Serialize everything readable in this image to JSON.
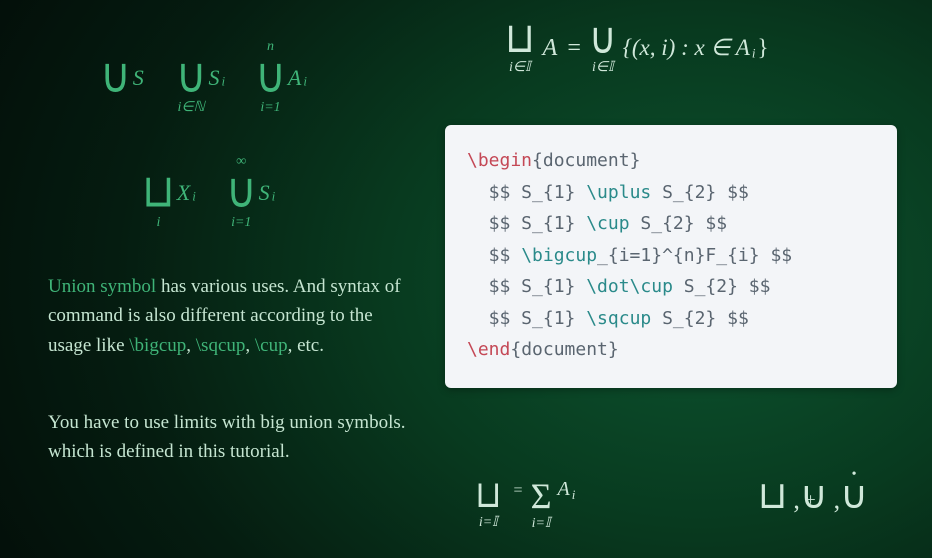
{
  "formulas": {
    "row1": {
      "t1": {
        "glyph": "∪",
        "body": "S"
      },
      "t2": {
        "glyph": "∪",
        "sub": "i∈ℕ",
        "body": "S",
        "bodysub": "i"
      },
      "t3": {
        "glyph": "∪",
        "sup": "n",
        "sub": "i=1",
        "body": "A",
        "bodysub": "i"
      }
    },
    "row2": {
      "t1": {
        "glyph": "⊔",
        "sub": "i",
        "body": "X",
        "bodysub": "i"
      },
      "t2": {
        "glyph": "∪",
        "sup": "∞",
        "sub": "i=1",
        "body": "S",
        "bodysub": "i"
      }
    },
    "topright": {
      "left": {
        "glyph": "⊔",
        "sub": "i∈𝕀",
        "body": "A"
      },
      "eq": "=",
      "right": {
        "glyph": "∪",
        "sub": "i∈𝕀",
        "body": "{(x, i) : x ∈ A",
        "bodysub": "i",
        "tail": "}"
      }
    },
    "bottomleft": {
      "left": {
        "glyph": "⊔",
        "sub": "i=𝕀"
      },
      "eq": "=",
      "right": {
        "glyph": "Σ",
        "sub": "i=𝕀",
        "body": "A",
        "bodysub": "i"
      }
    },
    "bottomright": {
      "s1": "⊔",
      "s2": "∪",
      "s3": "∪",
      "comma": ","
    }
  },
  "text": {
    "p1": {
      "lead": "Union symbol",
      "rest1": " has various uses. And syntax of command is also different according to the usage like ",
      "cmd1": "\\bigcup",
      "sep": ", ",
      "cmd2": "\\sqcup",
      "cmd3": "\\cup",
      "tail": ", etc."
    },
    "p2": "You have to use limits with big union symbols. which is defined in this tutorial."
  },
  "code": {
    "l1": {
      "a": "\\begin",
      "b": "{document}"
    },
    "l2": {
      "pre": "  $$ S_{1} ",
      "cmd": "\\uplus",
      "post": " S_{2} $$"
    },
    "l3": {
      "pre": "  $$ S_{1} ",
      "cmd": "\\cup",
      "post": " S_{2} $$"
    },
    "l4": {
      "pre": "  $$ ",
      "cmd": "\\bigcup",
      "post": "_{i=1}^{n}F_{i} $$"
    },
    "l5": {
      "pre": "  $$ S_{1} ",
      "cmd": "\\dot\\cup",
      "post": " S_{2} $$"
    },
    "l6": {
      "pre": "  $$ S_{1} ",
      "cmd": "\\sqcup",
      "post": " S_{2} $$"
    },
    "l7": {
      "a": "\\end",
      "b": "{document}"
    }
  }
}
